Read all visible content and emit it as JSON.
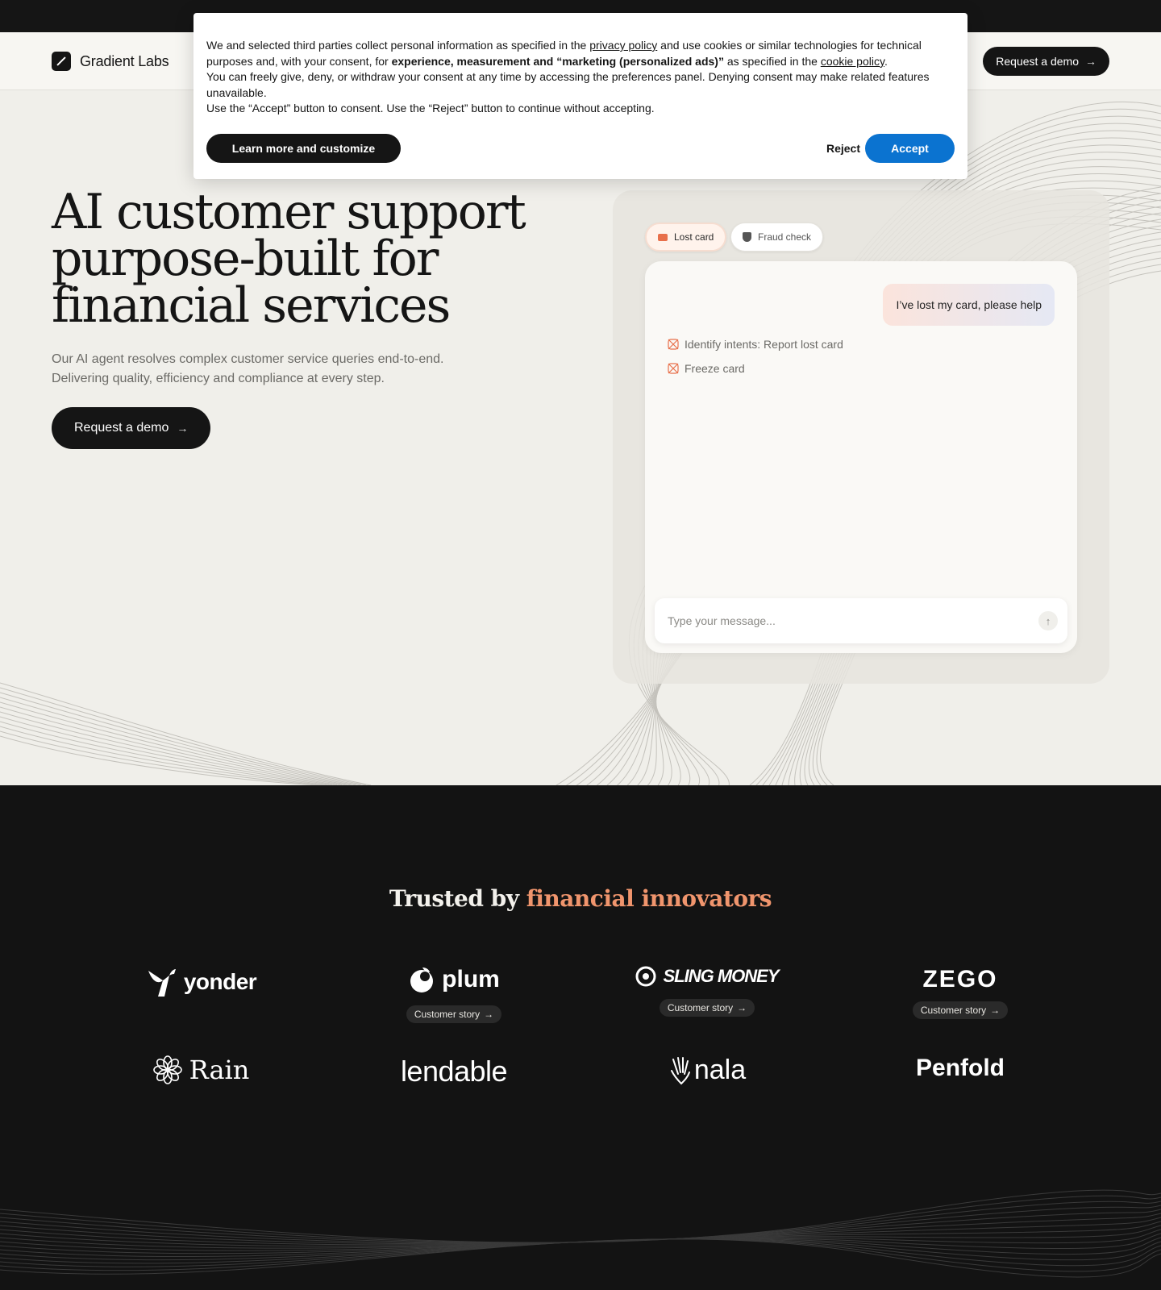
{
  "header": {
    "brand": "Gradient Labs",
    "cta_label": "Request a demo"
  },
  "hero": {
    "title_lines": [
      "AI customer support",
      "purpose-built for",
      "financial services"
    ],
    "subtitle": "Our AI agent resolves complex customer service queries end-to-end. Delivering quality, efficiency and compliance at every step.",
    "cta_label": "Request a demo"
  },
  "demo": {
    "chips": [
      {
        "label": "Lost card",
        "icon": "card-icon",
        "active": true
      },
      {
        "label": "Fraud check",
        "icon": "shield-icon",
        "active": false
      }
    ],
    "user_message": "I’ve lost my card, please help",
    "steps": [
      {
        "label": "Identify intents: Report lost card",
        "icon": "agent-sparkle-icon"
      },
      {
        "label": "Freeze card",
        "icon": "agent-sparkle-icon"
      }
    ],
    "input_placeholder": "Type your message...",
    "send_icon": "arrow-up-icon"
  },
  "trusted": {
    "prefix": "Trusted by ",
    "accent": "financial innovators",
    "accent_color": "#f0956d",
    "logos": [
      {
        "name": "yonder",
        "story": ""
      },
      {
        "name": "plum",
        "story": "Customer story"
      },
      {
        "name": "SLING MONEY",
        "story": "Customer story"
      },
      {
        "name": "ZEGO",
        "story": "Customer story"
      },
      {
        "name": "Rain",
        "story": ""
      },
      {
        "name": "lendable",
        "story": ""
      },
      {
        "name": "nala",
        "story": ""
      },
      {
        "name": "Penfold",
        "story": ""
      }
    ]
  },
  "consent": {
    "line1_a": "We and selected third parties collect personal information as specified in the ",
    "privacy_link": "privacy policy",
    "line1_b": " and use cookies or similar technologies for technical purposes and, with your consent, for ",
    "bold_purposes": "experience, measurement and “marketing (personalized ads)”",
    "line1_c": " as specified in the ",
    "cookie_link": "cookie policy",
    "line1_d": ".",
    "line2": "You can freely give, deny, or withdraw your consent at any time by accessing the preferences panel. Denying consent may make related features unavailable.",
    "line3": "Use the “Accept” button to consent. Use the “Reject” button to continue without accepting.",
    "learn_label": "Learn more and customize",
    "reject_label": "Reject",
    "accept_label": "Accept",
    "accept_color": "#0b73d0"
  }
}
